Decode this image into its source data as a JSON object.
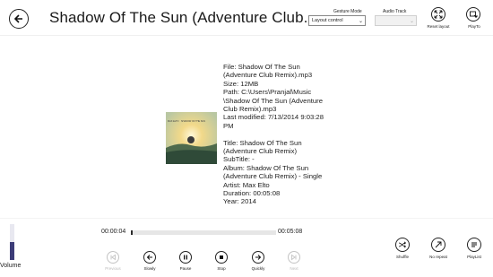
{
  "header": {
    "title": "Shadow Of The Sun (Adventure Club...",
    "gesture_mode_label": "Gesture Mode",
    "gesture_mode_value": "Layout control",
    "audio_track_label": "Audio Track",
    "audio_track_value": "",
    "reset_layout_label": "Reset layout",
    "playto_label": "PlayTo"
  },
  "info": {
    "file_lines": [
      "File: Shadow Of The Sun",
      "(Adventure Club Remix).mp3",
      "Size: 12MB",
      "Path: C:\\Users\\Pranjal\\Music",
      "\\Shadow Of The Sun (Adventure",
      "Club Remix).mp3",
      "Last modified: 7/13/2014 9:03:28",
      "PM"
    ],
    "meta_lines": [
      "Title: Shadow Of The Sun",
      "(Adventure Club Remix)",
      "SubTitle: -",
      "Album: Shadow Of The Sun",
      "(Adventure Club Remix) - Single",
      "Artist: Max Elto",
      "Duration: 00:05:08",
      "Year: 2014"
    ]
  },
  "cover": {
    "artist_text": "MAX ELTO",
    "title_text": "SHADOW OF THE SUN"
  },
  "player": {
    "current_time": "00:00:04",
    "total_time": "00:05:08",
    "progress_fraction": 0.013,
    "volume_label": "Volume",
    "volume_fraction": 0.5,
    "controls": [
      {
        "label": "Previous",
        "enabled": false
      },
      {
        "label": "Slowly",
        "enabled": true
      },
      {
        "label": "Pause",
        "enabled": true
      },
      {
        "label": "Stop",
        "enabled": true
      },
      {
        "label": "Quickly",
        "enabled": true
      },
      {
        "label": "Next",
        "enabled": false
      }
    ],
    "right_buttons": [
      {
        "label": "Shuffle"
      },
      {
        "label": "No repeat"
      },
      {
        "label": "PlayList"
      }
    ]
  },
  "colors": {
    "accent": "#3c3c78",
    "disabled": "#c4c4c4"
  }
}
